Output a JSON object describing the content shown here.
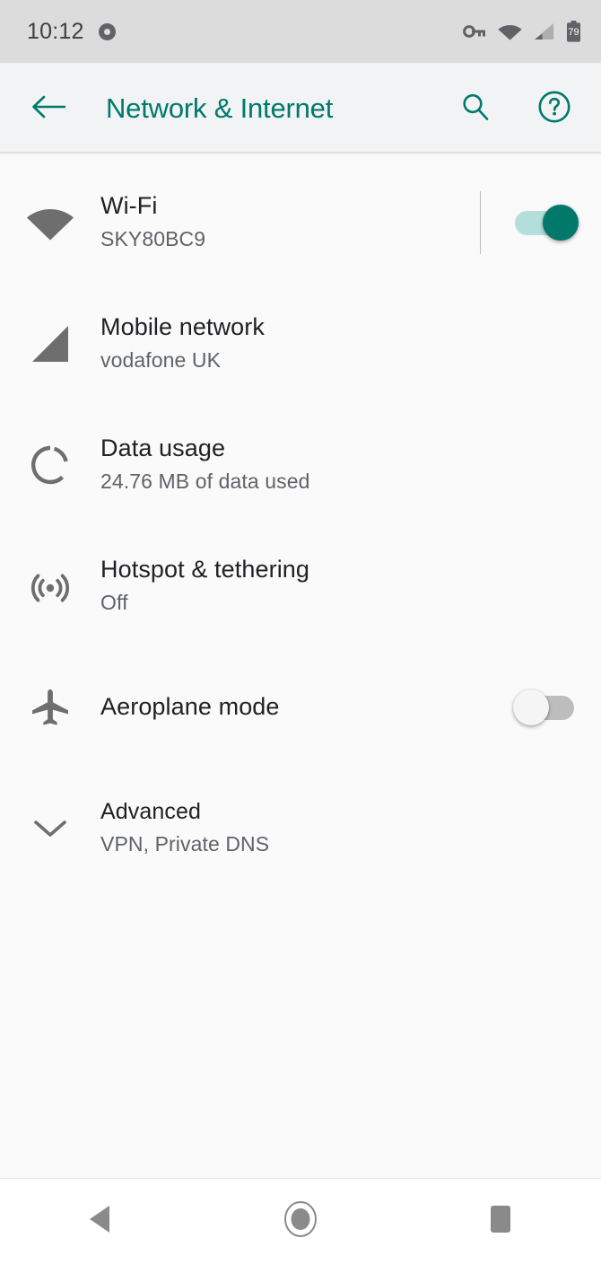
{
  "status_bar": {
    "time": "10:12",
    "record_icon": "record-dot-icon",
    "icons": [
      "vpn-key-icon",
      "wifi-icon",
      "cellular-signal-icon",
      "battery-icon"
    ],
    "battery_level": "79"
  },
  "app_bar": {
    "back_icon": "back-arrow-icon",
    "title": "Network & Internet",
    "search_icon": "search-icon",
    "help_icon": "help-icon",
    "accent_color": "#00796b"
  },
  "settings": {
    "rows": [
      {
        "icon": "wifi-icon",
        "title": "Wi-Fi",
        "subtitle": "SKY80BC9",
        "control": "switch",
        "switch_state": "on",
        "divider": true
      },
      {
        "icon": "cellular-signal-icon",
        "title": "Mobile network",
        "subtitle": "vodafone UK",
        "control": "none"
      },
      {
        "icon": "data-usage-icon",
        "title": "Data usage",
        "subtitle": "24.76 MB of data used",
        "control": "none"
      },
      {
        "icon": "hotspot-tethering-icon",
        "title": "Hotspot & tethering",
        "subtitle": "Off",
        "control": "none"
      },
      {
        "icon": "aeroplane-icon",
        "title": "Aeroplane mode",
        "subtitle": "",
        "control": "switch",
        "switch_state": "off"
      },
      {
        "icon": "chevron-down-icon",
        "title": "Advanced",
        "subtitle": "VPN, Private DNS",
        "control": "none"
      }
    ]
  },
  "nav_bar": {
    "back_label": "back-triangle-icon",
    "home_label": "home-circle-icon",
    "recents_label": "recents-square-icon"
  },
  "colors": {
    "accent": "#00796b",
    "switch_on_track": "#b2dfdb",
    "switch_off_track": "#bdbdbd",
    "icon_gray": "#6e6e6e",
    "title_text": "#202124",
    "subtitle_text": "#5f6368",
    "status_bar_bg": "#dcdcdc",
    "app_bar_bg": "#f1f3f4",
    "content_bg": "#fafafa"
  }
}
